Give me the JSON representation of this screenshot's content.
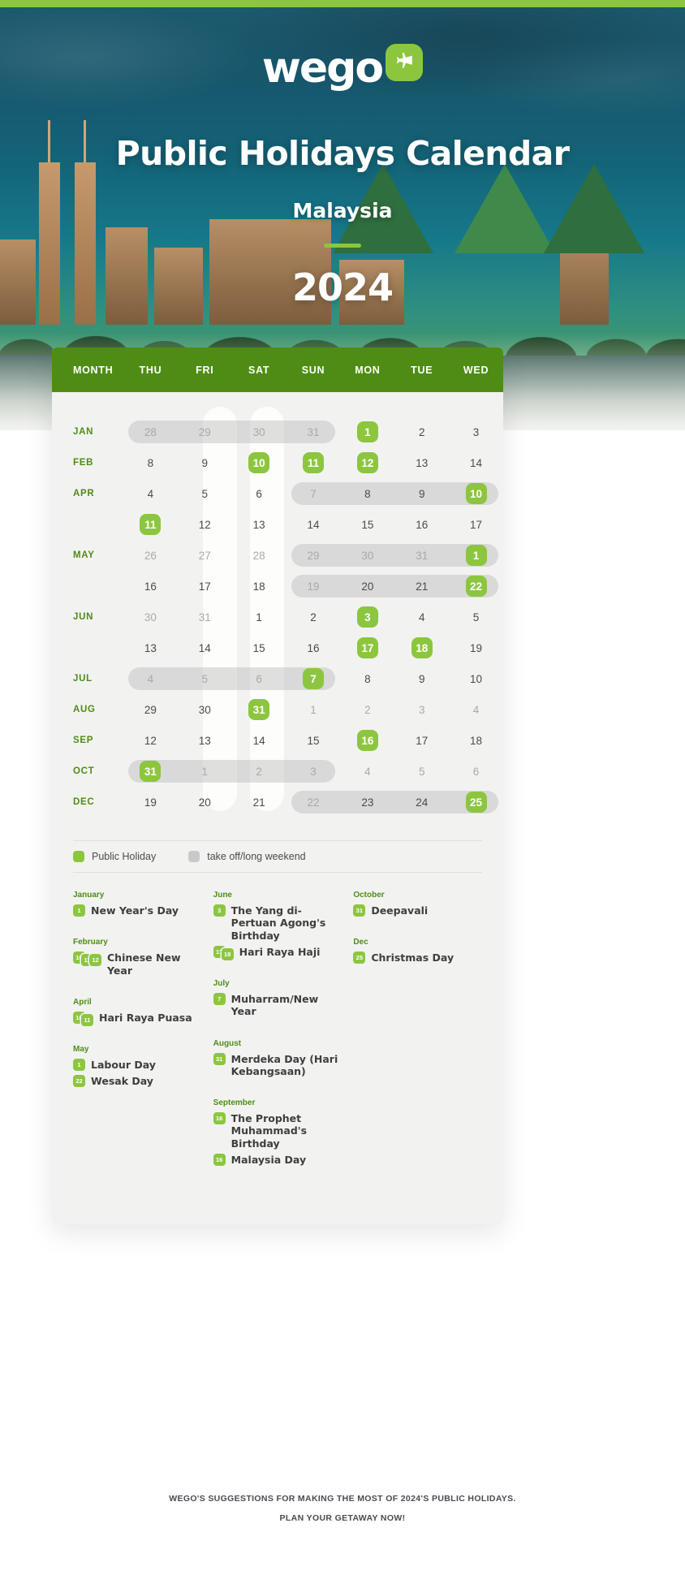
{
  "brand": {
    "logo_text": "wego",
    "logo_icon": "airplane-icon",
    "accent_green": "#8cc63f",
    "header_green": "#4f8c15"
  },
  "hero": {
    "title": "Public Holidays Calendar",
    "country": "Malaysia",
    "year": "2024"
  },
  "calendar": {
    "columns": [
      "MONTH",
      "THU",
      "FRI",
      "SAT",
      "SUN",
      "MON",
      "TUE",
      "WED"
    ],
    "rows": [
      {
        "month": "JAN",
        "days": [
          {
            "n": "28",
            "state": "dim"
          },
          {
            "n": "29",
            "state": "dim"
          },
          {
            "n": "30",
            "state": "dim"
          },
          {
            "n": "31",
            "state": "dim"
          },
          {
            "n": "1",
            "state": "holiday"
          },
          {
            "n": "2",
            "state": "normal"
          },
          {
            "n": "3",
            "state": "normal"
          }
        ],
        "runs": [
          {
            "start": 1,
            "end": 4
          }
        ]
      },
      {
        "month": "FEB",
        "days": [
          {
            "n": "8",
            "state": "normal"
          },
          {
            "n": "9",
            "state": "normal"
          },
          {
            "n": "10",
            "state": "holiday"
          },
          {
            "n": "11",
            "state": "holiday"
          },
          {
            "n": "12",
            "state": "holiday"
          },
          {
            "n": "13",
            "state": "normal"
          },
          {
            "n": "14",
            "state": "normal"
          }
        ],
        "runs": []
      },
      {
        "month": "APR",
        "days": [
          {
            "n": "4",
            "state": "normal"
          },
          {
            "n": "5",
            "state": "normal"
          },
          {
            "n": "6",
            "state": "normal"
          },
          {
            "n": "7",
            "state": "dim"
          },
          {
            "n": "8",
            "state": "normal"
          },
          {
            "n": "9",
            "state": "normal"
          },
          {
            "n": "10",
            "state": "holiday"
          }
        ],
        "runs": [
          {
            "start": 4,
            "end": 7
          }
        ]
      },
      {
        "month": "",
        "days": [
          {
            "n": "11",
            "state": "holiday"
          },
          {
            "n": "12",
            "state": "normal"
          },
          {
            "n": "13",
            "state": "normal"
          },
          {
            "n": "14",
            "state": "normal"
          },
          {
            "n": "15",
            "state": "normal"
          },
          {
            "n": "16",
            "state": "normal"
          },
          {
            "n": "17",
            "state": "normal"
          }
        ],
        "runs": []
      },
      {
        "month": "MAY",
        "days": [
          {
            "n": "26",
            "state": "dim"
          },
          {
            "n": "27",
            "state": "dim"
          },
          {
            "n": "28",
            "state": "dim"
          },
          {
            "n": "29",
            "state": "dim"
          },
          {
            "n": "30",
            "state": "dim"
          },
          {
            "n": "31",
            "state": "dim"
          },
          {
            "n": "1",
            "state": "holiday"
          }
        ],
        "runs": [
          {
            "start": 4,
            "end": 7
          }
        ]
      },
      {
        "month": "",
        "days": [
          {
            "n": "16",
            "state": "normal"
          },
          {
            "n": "17",
            "state": "normal"
          },
          {
            "n": "18",
            "state": "normal"
          },
          {
            "n": "19",
            "state": "dim"
          },
          {
            "n": "20",
            "state": "normal"
          },
          {
            "n": "21",
            "state": "normal"
          },
          {
            "n": "22",
            "state": "holiday"
          }
        ],
        "runs": [
          {
            "start": 4,
            "end": 7
          }
        ]
      },
      {
        "month": "JUN",
        "days": [
          {
            "n": "30",
            "state": "dim"
          },
          {
            "n": "31",
            "state": "dim"
          },
          {
            "n": "1",
            "state": "normal"
          },
          {
            "n": "2",
            "state": "normal"
          },
          {
            "n": "3",
            "state": "holiday"
          },
          {
            "n": "4",
            "state": "normal"
          },
          {
            "n": "5",
            "state": "normal"
          }
        ],
        "runs": []
      },
      {
        "month": "",
        "days": [
          {
            "n": "13",
            "state": "normal"
          },
          {
            "n": "14",
            "state": "normal"
          },
          {
            "n": "15",
            "state": "normal"
          },
          {
            "n": "16",
            "state": "normal"
          },
          {
            "n": "17",
            "state": "holiday"
          },
          {
            "n": "18",
            "state": "holiday"
          },
          {
            "n": "19",
            "state": "normal"
          }
        ],
        "runs": []
      },
      {
        "month": "JUL",
        "days": [
          {
            "n": "4",
            "state": "dim"
          },
          {
            "n": "5",
            "state": "dim"
          },
          {
            "n": "6",
            "state": "dim"
          },
          {
            "n": "7",
            "state": "holiday"
          },
          {
            "n": "8",
            "state": "normal"
          },
          {
            "n": "9",
            "state": "normal"
          },
          {
            "n": "10",
            "state": "normal"
          }
        ],
        "runs": [
          {
            "start": 1,
            "end": 4
          }
        ]
      },
      {
        "month": "AUG",
        "days": [
          {
            "n": "29",
            "state": "normal"
          },
          {
            "n": "30",
            "state": "normal"
          },
          {
            "n": "31",
            "state": "holiday"
          },
          {
            "n": "1",
            "state": "dim"
          },
          {
            "n": "2",
            "state": "dim"
          },
          {
            "n": "3",
            "state": "dim"
          },
          {
            "n": "4",
            "state": "dim"
          }
        ],
        "runs": []
      },
      {
        "month": "SEP",
        "days": [
          {
            "n": "12",
            "state": "normal"
          },
          {
            "n": "13",
            "state": "normal"
          },
          {
            "n": "14",
            "state": "normal"
          },
          {
            "n": "15",
            "state": "normal"
          },
          {
            "n": "16",
            "state": "holiday"
          },
          {
            "n": "17",
            "state": "normal"
          },
          {
            "n": "18",
            "state": "normal"
          }
        ],
        "runs": []
      },
      {
        "month": "OCT",
        "days": [
          {
            "n": "31",
            "state": "holiday"
          },
          {
            "n": "1",
            "state": "dim"
          },
          {
            "n": "2",
            "state": "dim"
          },
          {
            "n": "3",
            "state": "dim"
          },
          {
            "n": "4",
            "state": "dim"
          },
          {
            "n": "5",
            "state": "dim"
          },
          {
            "n": "6",
            "state": "dim"
          }
        ],
        "runs": [
          {
            "start": 1,
            "end": 4
          }
        ]
      },
      {
        "month": "DEC",
        "days": [
          {
            "n": "19",
            "state": "normal"
          },
          {
            "n": "20",
            "state": "normal"
          },
          {
            "n": "21",
            "state": "normal"
          },
          {
            "n": "22",
            "state": "dim"
          },
          {
            "n": "23",
            "state": "normal"
          },
          {
            "n": "24",
            "state": "normal"
          },
          {
            "n": "25",
            "state": "holiday"
          }
        ],
        "runs": [
          {
            "start": 4,
            "end": 7
          }
        ]
      }
    ]
  },
  "legend": {
    "public_holiday": "Public Holiday",
    "long_weekend": "take off/long weekend"
  },
  "holiday_list": {
    "columns": [
      [
        {
          "month": "January",
          "items": [
            {
              "dates": [
                "1"
              ],
              "name": "New Year's Day"
            }
          ]
        },
        {
          "month": "February",
          "items": [
            {
              "dates": [
                "10",
                "11",
                "12"
              ],
              "name": "Chinese New Year"
            }
          ]
        },
        {
          "month": "April",
          "items": [
            {
              "dates": [
                "10",
                "11"
              ],
              "name": "Hari Raya Puasa"
            }
          ]
        },
        {
          "month": "May",
          "items": [
            {
              "dates": [
                "1"
              ],
              "name": "Labour Day"
            },
            {
              "dates": [
                "22"
              ],
              "name": "Wesak Day"
            }
          ]
        }
      ],
      [
        {
          "month": "June",
          "items": [
            {
              "dates": [
                "3"
              ],
              "name": "The Yang di-Pertuan Agong's Birthday"
            },
            {
              "dates": [
                "17",
                "18"
              ],
              "name": "Hari Raya Haji"
            }
          ]
        },
        {
          "month": "July",
          "items": [
            {
              "dates": [
                "7"
              ],
              "name": "Muharram/New Year"
            }
          ]
        },
        {
          "month": "August",
          "items": [
            {
              "dates": [
                "31"
              ],
              "name": "Merdeka Day (Hari Kebangsaan)"
            }
          ]
        },
        {
          "month": "September",
          "items": [
            {
              "dates": [
                "16"
              ],
              "name": "The Prophet Muhammad's Birthday"
            },
            {
              "dates": [
                "16"
              ],
              "name": "Malaysia Day"
            }
          ]
        }
      ],
      [
        {
          "month": "October",
          "items": [
            {
              "dates": [
                "31"
              ],
              "name": "Deepavali"
            }
          ]
        },
        {
          "month": "Dec",
          "items": [
            {
              "dates": [
                "25"
              ],
              "name": "Christmas Day"
            }
          ]
        }
      ]
    ]
  },
  "footer": {
    "line1": "WEGO'S SUGGESTIONS FOR MAKING THE MOST OF 2024'S PUBLIC HOLIDAYS.",
    "line2": "PLAN YOUR GETAWAY NOW!"
  }
}
